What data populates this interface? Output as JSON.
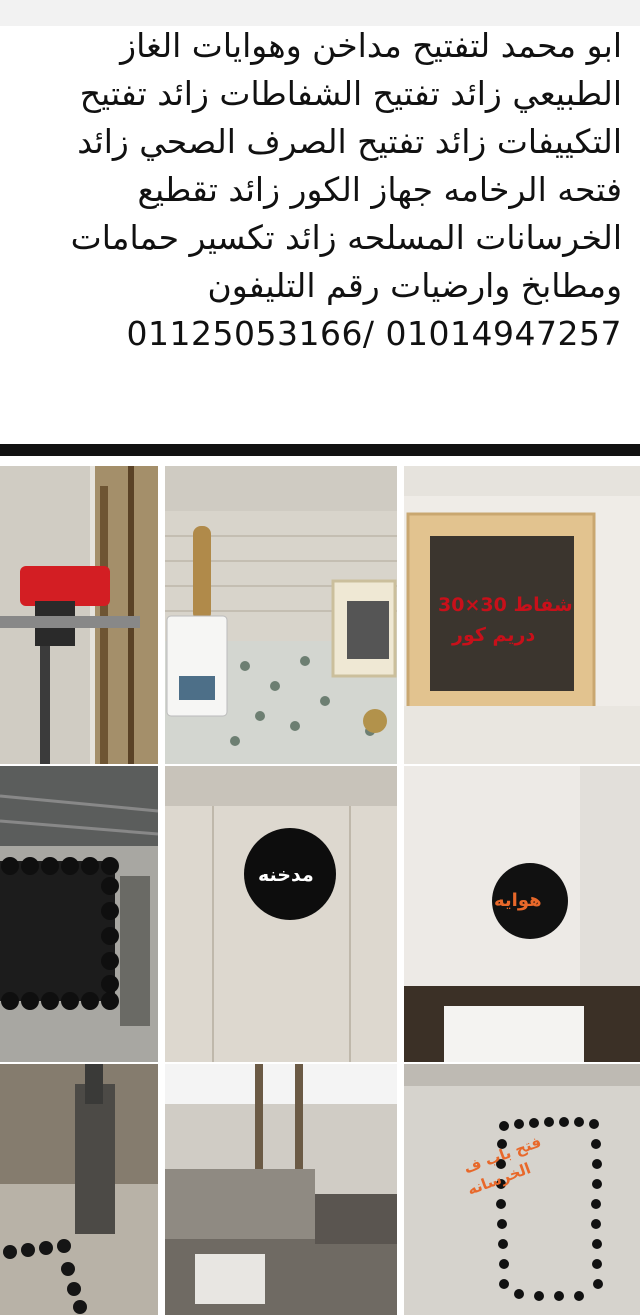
{
  "post": {
    "lines": [
      "ابو محمد لتفتيح مداخن وهوايات الغاز",
      "الطبيعي زائد تفتيح الشفاطات زائد تفتيح",
      "التكييفات زائد تفتيح الصرف الصحي زائد",
      "فتحه الرخامه جهاز الكور زائد تقطيع",
      "الخرسانات المسلحه زائد تكسير حمامات",
      "ومطابخ وارضيات رقم التليفون",
      "01125053166/ 01014947257"
    ]
  },
  "photos": {
    "vent_size_label": "شفاط 30×30",
    "brand_label": "دريم كور",
    "chimney_label": "مدخنه",
    "air_vent_label": "هوايه",
    "door_opening_label_1": "فتح باب ف",
    "door_opening_label_2": "الخرسانه"
  },
  "colors": {
    "text": "#111111",
    "divider": "#111111",
    "label_red": "#c8101a",
    "label_orange": "#e8682a"
  }
}
